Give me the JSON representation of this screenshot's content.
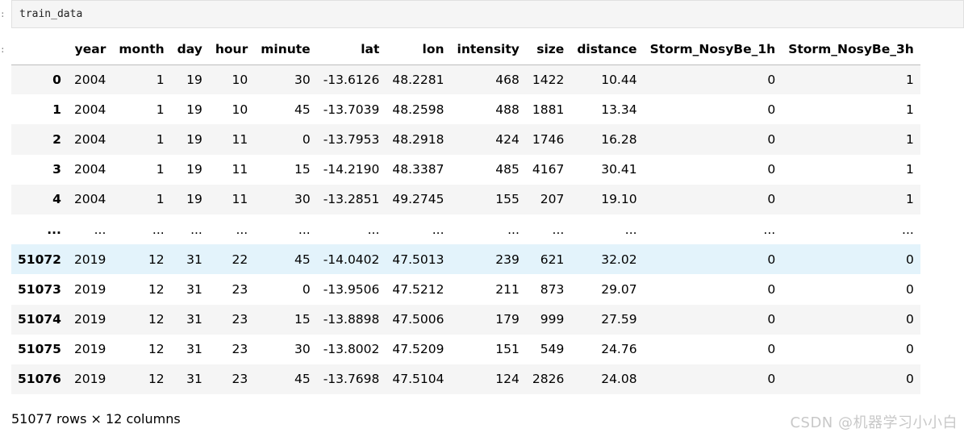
{
  "input_cell": {
    "code": "train_data",
    "prompt_marker": ":"
  },
  "output": {
    "prompt_marker": ":",
    "columns": [
      "",
      "year",
      "month",
      "day",
      "hour",
      "minute",
      "lat",
      "lon",
      "intensity",
      "size",
      "distance",
      "Storm_NosyBe_1h",
      "Storm_NosyBe_3h"
    ],
    "rows": [
      {
        "index": "0",
        "values": [
          "2004",
          "1",
          "19",
          "10",
          "30",
          "-13.6126",
          "48.2281",
          "468",
          "1422",
          "10.44",
          "0",
          "1"
        ]
      },
      {
        "index": "1",
        "values": [
          "2004",
          "1",
          "19",
          "10",
          "45",
          "-13.7039",
          "48.2598",
          "488",
          "1881",
          "13.34",
          "0",
          "1"
        ]
      },
      {
        "index": "2",
        "values": [
          "2004",
          "1",
          "19",
          "11",
          "0",
          "-13.7953",
          "48.2918",
          "424",
          "1746",
          "16.28",
          "0",
          "1"
        ]
      },
      {
        "index": "3",
        "values": [
          "2004",
          "1",
          "19",
          "11",
          "15",
          "-14.2190",
          "48.3387",
          "485",
          "4167",
          "30.41",
          "0",
          "1"
        ]
      },
      {
        "index": "4",
        "values": [
          "2004",
          "1",
          "19",
          "11",
          "30",
          "-13.2851",
          "49.2745",
          "155",
          "207",
          "19.10",
          "0",
          "1"
        ]
      },
      {
        "index": "...",
        "values": [
          "...",
          "...",
          "...",
          "...",
          "...",
          "...",
          "...",
          "...",
          "...",
          "...",
          "...",
          "..."
        ]
      },
      {
        "index": "51072",
        "values": [
          "2019",
          "12",
          "31",
          "22",
          "45",
          "-14.0402",
          "47.5013",
          "239",
          "621",
          "32.02",
          "0",
          "0"
        ],
        "hover": true
      },
      {
        "index": "51073",
        "values": [
          "2019",
          "12",
          "31",
          "23",
          "0",
          "-13.9506",
          "47.5212",
          "211",
          "873",
          "29.07",
          "0",
          "0"
        ]
      },
      {
        "index": "51074",
        "values": [
          "2019",
          "12",
          "31",
          "23",
          "15",
          "-13.8898",
          "47.5006",
          "179",
          "999",
          "27.59",
          "0",
          "0"
        ]
      },
      {
        "index": "51075",
        "values": [
          "2019",
          "12",
          "31",
          "23",
          "30",
          "-13.8002",
          "47.5209",
          "151",
          "549",
          "24.76",
          "0",
          "0"
        ]
      },
      {
        "index": "51076",
        "values": [
          "2019",
          "12",
          "31",
          "23",
          "45",
          "-13.7698",
          "47.5104",
          "124",
          "2826",
          "24.08",
          "0",
          "0"
        ]
      }
    ],
    "shape_text": "51077 rows × 12 columns"
  },
  "watermark": "CSDN @机器学习小小白"
}
